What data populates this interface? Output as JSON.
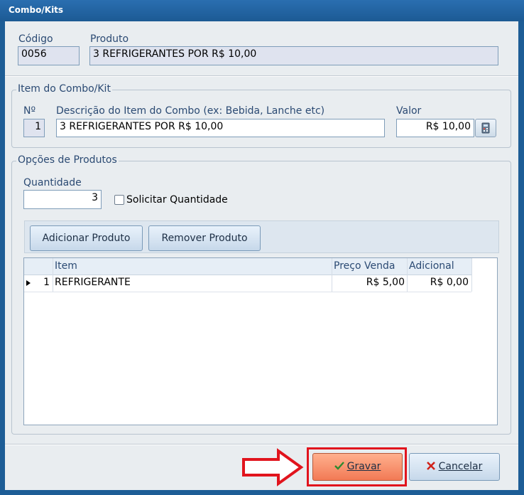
{
  "window": {
    "title": "Combo/Kits"
  },
  "header": {
    "codigo_label": "Código",
    "codigo_value": "0056",
    "produto_label": "Produto",
    "produto_value": "3 REFRIGERANTES POR R$ 10,00"
  },
  "item_group": {
    "title": "Item do Combo/Kit",
    "numero_label": "Nº",
    "numero_value": "1",
    "descricao_label": "Descrição do Item do Combo (ex: Bebida, Lanche etc)",
    "descricao_value": "3 REFRIGERANTES POR R$ 10,00",
    "valor_label": "Valor",
    "valor_value": "R$ 10,00",
    "calc_icon": "calculator-icon"
  },
  "options_group": {
    "title": "Opções de Produtos",
    "quantidade_label": "Quantidade",
    "quantidade_value": "3",
    "solicitar_label": "Solicitar Quantidade",
    "solicitar_checked": false,
    "add_button": "Adicionar Produto",
    "remove_button": "Remover Produto",
    "table": {
      "columns": [
        "Item",
        "Preço Venda",
        "Adicional"
      ],
      "rows": [
        {
          "num": "1",
          "item": "REFRIGERANTE",
          "preco": "R$ 5,00",
          "adicional": "R$ 0,00"
        }
      ]
    }
  },
  "footer": {
    "gravar_label": "Gravar",
    "cancelar_label": "Cancelar",
    "gravar_icon": "check-icon",
    "cancelar_icon": "x-icon",
    "arrow_icon": "arrow-right-icon",
    "highlight_color": "#e1141d"
  }
}
